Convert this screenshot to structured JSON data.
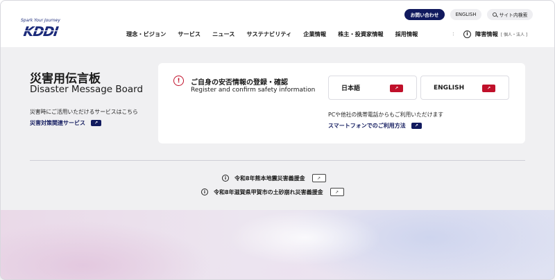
{
  "header": {
    "logo": {
      "tagline": "Spark Your Journey",
      "word": "KDDI"
    },
    "utility": {
      "contact": "お問い合わせ",
      "english": "ENGLISH",
      "search": "サイト内検索"
    },
    "nav": [
      "理念・ビジョン",
      "サービス",
      "ニュース",
      "サステナビリティ",
      "企業情報",
      "株主・投資家情報",
      "採用情報"
    ],
    "nav_separator": ":",
    "disaster": {
      "label": "障害情報",
      "sub": "[ 個人・法人 ]"
    }
  },
  "main": {
    "title_jp": "災害用伝言板",
    "title_en": "Disaster Message Board",
    "description": "災害時にご活用いただけるサービスはこちら",
    "related_link": "災害対策関連サービス"
  },
  "card": {
    "title_jp": "ご自身の安否情報の登録・確認",
    "title_en": "Register and confirm safety information",
    "buttons": {
      "japanese": "日本語",
      "english": "ENGLISH"
    },
    "note": "PCや他社の携帯電話からもご利用いただけます",
    "smartphone_link": "スマートフォンでのご利用方法"
  },
  "news": [
    "令和8年熊本地震災害義援金",
    "令和8年滋賀県甲賀市の土砂崩れ災害義援金"
  ],
  "icons": {
    "external_arrow": "↗",
    "info": "i",
    "warning": "!"
  },
  "colors": {
    "brand_navy": "#111a5e",
    "accent_red": "#c0102a",
    "page_bg": "#f0f0f2"
  }
}
